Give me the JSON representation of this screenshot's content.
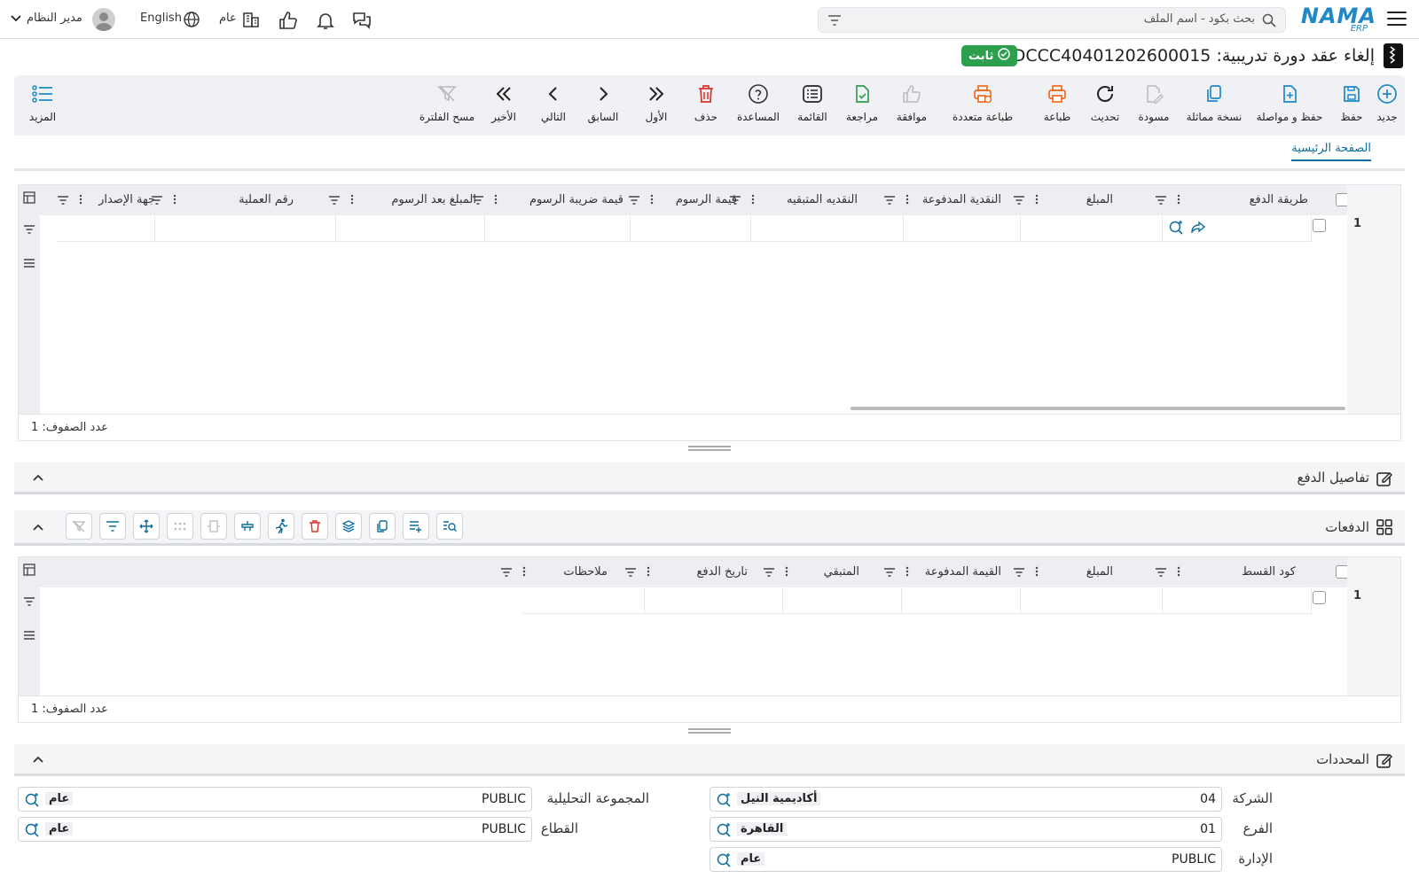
{
  "topbar": {
    "logo_main": "NAMA",
    "logo_sub": "ERP",
    "search_placeholder": "بحث بكود - اسم الملف",
    "branch": "عام",
    "language": "English",
    "user_name": "مدير النظام"
  },
  "header": {
    "title": "إلغاء عقد دورة تدريبية: EDCCC40401202600015",
    "status": "ثابت"
  },
  "toolbar": {
    "new": "جديد",
    "save": "حفظ",
    "save_continue": "حفظ و مواصلة",
    "duplicate": "نسخة مماثلة",
    "draft": "مسودة",
    "refresh": "تحديث",
    "print": "طباعة",
    "multi_print": "طباعة متعددة",
    "approve": "موافقة",
    "review": "مراجعة",
    "list": "القائمة",
    "help": "المساعدة",
    "delete": "حذف",
    "first": "الأول",
    "previous": "السابق",
    "next": "التالي",
    "last": "الأخير",
    "clear_filter": "مسح الفلترة",
    "more": "المزيد"
  },
  "tabs": {
    "main": "الصفحة الرئيسية"
  },
  "payments_grid": {
    "columns": {
      "payment_method": "طريقة الدفع",
      "amount": "المبلغ",
      "paid_cash": "النقدية المدفوعة",
      "remaining_cash": "النقديه المتبقيه",
      "fees_value": "قيمة الرسوم",
      "fees_tax": "قيمة ضريبة الرسوم",
      "amount_after_fees": "المبلغ بعد الرسوم",
      "transaction_no": "رقم العملية",
      "issuer": "جهة الإصدار"
    },
    "row_number": "1",
    "row_count": "عدد الصفوف: 1"
  },
  "payment_details_section": {
    "title": "تفاصيل الدفع"
  },
  "installments_section": {
    "title": "الدفعات"
  },
  "installments_grid": {
    "columns": {
      "installment_code": "كود القسط",
      "amount": "المبلغ",
      "paid_value": "القيمة المدفوعة",
      "remaining": "المتبقي",
      "payment_date": "تاريخ الدفع",
      "notes": "ملاحظات"
    },
    "row_number": "1",
    "row_count": "عدد الصفوف: 1"
  },
  "dimensions_section": {
    "title": "المحددات"
  },
  "dimensions": {
    "company": {
      "label": "الشركة",
      "code": "04",
      "name": "أكاديمية النيل"
    },
    "branch": {
      "label": "الفرع",
      "code": "01",
      "name": "القاهرة"
    },
    "department": {
      "label": "الإدارة",
      "code": "PUBLIC",
      "name": "عام"
    },
    "analysis_group": {
      "label": "المجموعة التحليلية",
      "code": "PUBLIC",
      "name": "عام"
    },
    "sector": {
      "label": "القطاع",
      "code": "PUBLIC",
      "name": "عام"
    }
  },
  "colors": {
    "accent": "#1e88c8",
    "teal": "#0d6e9c",
    "status_green": "#2e9e4f",
    "print_orange": "#f06a1d",
    "delete_red": "#d9342b",
    "review_green": "#2e9e4f"
  }
}
